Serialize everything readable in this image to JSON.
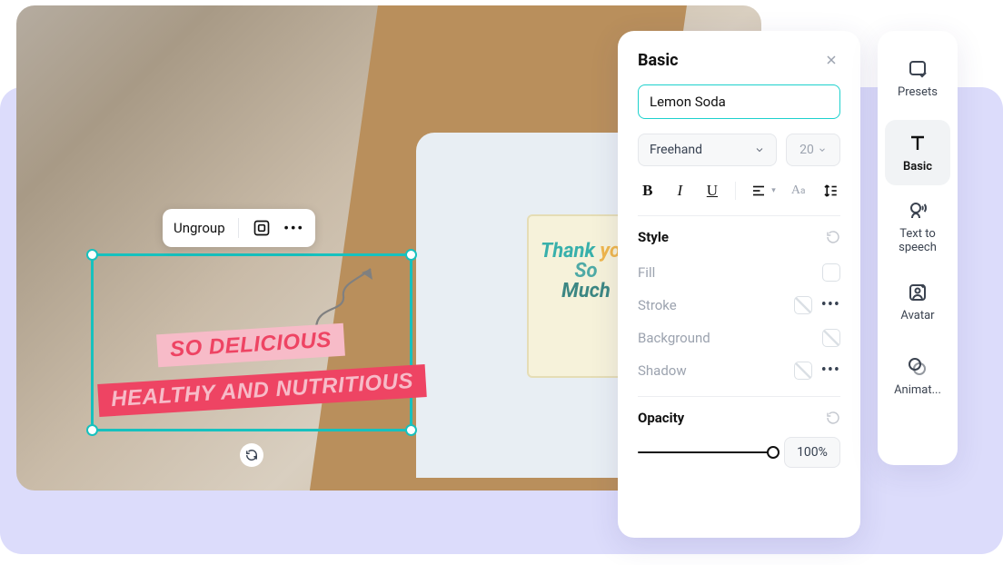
{
  "canvas": {
    "text1": "SO DELICIOUS",
    "text2": "HEALTHY AND NUTRITIOUS",
    "card_l1": "Thank",
    "card_l2": "you",
    "card_l3": "So",
    "card_l4": "Much"
  },
  "mini_toolbar": {
    "ungroup": "Ungroup"
  },
  "panel": {
    "title": "Basic",
    "text_value": "Lemon Soda",
    "font": "Freehand",
    "font_size": "20",
    "style_label": "Style",
    "fill": "Fill",
    "stroke": "Stroke",
    "background": "Background",
    "shadow": "Shadow",
    "opacity_label": "Opacity",
    "opacity_value": "100%"
  },
  "sidebar": {
    "presets": "Presets",
    "basic": "Basic",
    "tts": "Text to speech",
    "avatar": "Avatar",
    "animat": "Animat..."
  }
}
